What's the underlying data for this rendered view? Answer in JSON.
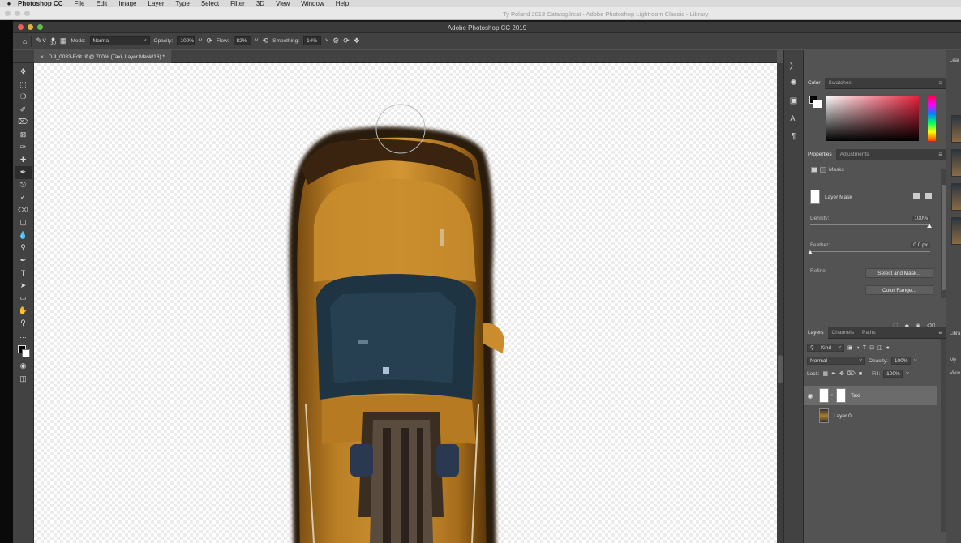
{
  "menubar": {
    "apple": "",
    "items": [
      "Photoshop CC",
      "File",
      "Edit",
      "Image",
      "Layer",
      "Type",
      "Select",
      "Filter",
      "3D",
      "View",
      "Window",
      "Help"
    ]
  },
  "lightroom": {
    "title": "Ty Poland 2018 Catalog.lrcat - Adobe Photoshop Lightroom Classic - Library"
  },
  "window": {
    "title": "Adobe Photoshop CC 2019"
  },
  "options": {
    "brush_size": "30",
    "mode_label": "Mode:",
    "mode_value": "Normal",
    "opacity_label": "Opacity:",
    "opacity_value": "100%",
    "flow_label": "Flow:",
    "flow_value": "82%",
    "smoothing_label": "Smoothing:",
    "smoothing_value": "14%"
  },
  "document": {
    "tab_title": "DJI_0033-Edit.tif @ 700% (Taxi, Layer Mask/16) *",
    "close": "×"
  },
  "color_panel": {
    "tabs": [
      "Color",
      "Swatches"
    ],
    "accent": "#e8213c"
  },
  "properties": {
    "tabs": [
      "Properties",
      "Adjustments"
    ],
    "masks_label": "Masks",
    "layer_mask_label": "Layer Mask",
    "density_label": "Density:",
    "density_value": "100%",
    "feather_label": "Feather:",
    "feather_value": "0.0 px",
    "refine_label": "Refine:",
    "select_mask_button": "Select and Mask...",
    "color_range_button": "Color Range..."
  },
  "layers_panel": {
    "tabs": [
      "Layers",
      "Channels",
      "Paths"
    ],
    "filter_kind": "Kind",
    "blend_mode": "Normal",
    "opacity_label": "Opacity:",
    "opacity_value": "100%",
    "lock_label": "Lock:",
    "fill_label": "Fill:",
    "fill_value": "100%",
    "layers": [
      {
        "name": "Taxi",
        "visible": true,
        "selected": true
      },
      {
        "name": "Layer 0",
        "visible": false,
        "selected": false
      }
    ]
  },
  "far_panel": {
    "labels": [
      "Lear",
      "Libra",
      "My",
      "View"
    ]
  },
  "colors": {
    "taxi": "#b3791f",
    "window": "#1f3443"
  }
}
